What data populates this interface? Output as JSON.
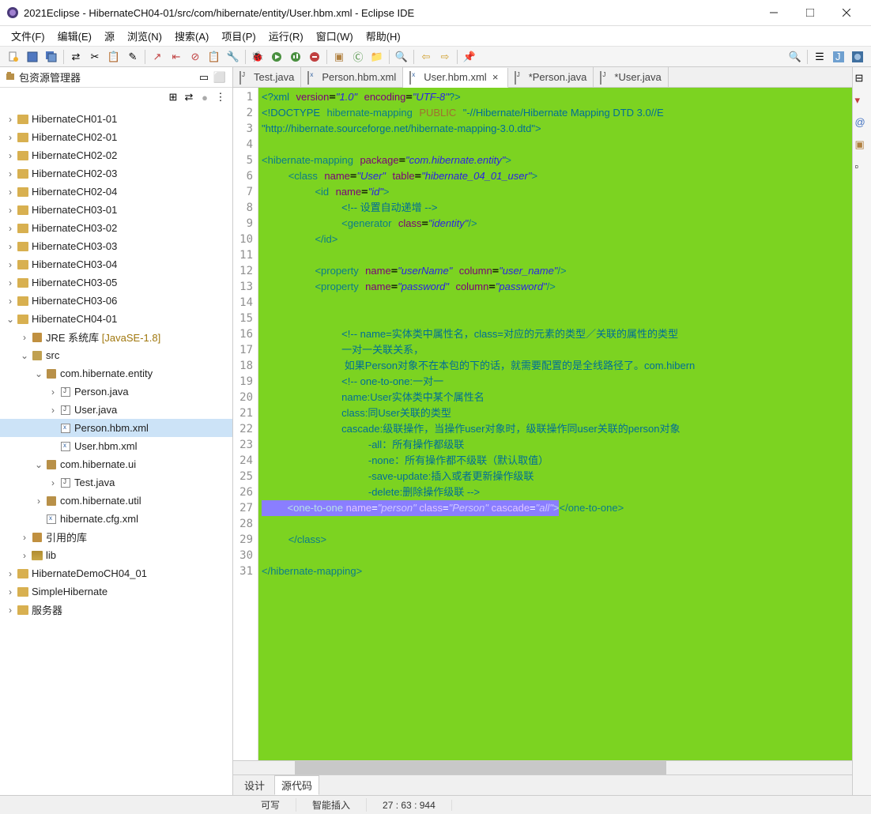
{
  "window": {
    "title": "2021Eclipse - HibernateCH04-01/src/com/hibernate/entity/User.hbm.xml - Eclipse IDE"
  },
  "menu": [
    "文件(F)",
    "编辑(E)",
    "源",
    "浏览(N)",
    "搜索(A)",
    "项目(P)",
    "运行(R)",
    "窗口(W)",
    "帮助(H)"
  ],
  "sidebar": {
    "title": "包资源管理器",
    "tree": [
      {
        "depth": 0,
        "exp": ">",
        "icon": "proj",
        "label": "HibernateCH01-01"
      },
      {
        "depth": 0,
        "exp": ">",
        "icon": "proj",
        "label": "HibernateCH02-01"
      },
      {
        "depth": 0,
        "exp": ">",
        "icon": "proj",
        "label": "HibernateCH02-02"
      },
      {
        "depth": 0,
        "exp": ">",
        "icon": "proj",
        "label": "HibernateCH02-03"
      },
      {
        "depth": 0,
        "exp": ">",
        "icon": "proj",
        "label": "HibernateCH02-04"
      },
      {
        "depth": 0,
        "exp": ">",
        "icon": "proj",
        "label": "HibernateCH03-01"
      },
      {
        "depth": 0,
        "exp": ">",
        "icon": "proj",
        "label": "HibernateCH03-02"
      },
      {
        "depth": 0,
        "exp": ">",
        "icon": "proj",
        "label": "HibernateCH03-03"
      },
      {
        "depth": 0,
        "exp": ">",
        "icon": "proj",
        "label": "HibernateCH03-04"
      },
      {
        "depth": 0,
        "exp": ">",
        "icon": "proj",
        "label": "HibernateCH03-05"
      },
      {
        "depth": 0,
        "exp": ">",
        "icon": "proj",
        "label": "HibernateCH03-06"
      },
      {
        "depth": 0,
        "exp": "v",
        "icon": "proj",
        "label": "HibernateCH04-01"
      },
      {
        "depth": 1,
        "exp": ">",
        "icon": "lib",
        "label": "JRE 系统库 [JavaSE-1.8]"
      },
      {
        "depth": 1,
        "exp": "v",
        "icon": "src",
        "label": "src"
      },
      {
        "depth": 2,
        "exp": "v",
        "icon": "pkg",
        "label": "com.hibernate.entity"
      },
      {
        "depth": 3,
        "exp": ">",
        "icon": "java",
        "label": "Person.java"
      },
      {
        "depth": 3,
        "exp": ">",
        "icon": "java",
        "label": "User.java"
      },
      {
        "depth": 3,
        "exp": " ",
        "icon": "xml",
        "label": "Person.hbm.xml",
        "selected": true
      },
      {
        "depth": 3,
        "exp": " ",
        "icon": "xml",
        "label": "User.hbm.xml"
      },
      {
        "depth": 2,
        "exp": "v",
        "icon": "pkg",
        "label": "com.hibernate.ui"
      },
      {
        "depth": 3,
        "exp": ">",
        "icon": "java",
        "label": "Test.java"
      },
      {
        "depth": 2,
        "exp": ">",
        "icon": "pkg",
        "label": "com.hibernate.util"
      },
      {
        "depth": 2,
        "exp": " ",
        "icon": "xml",
        "label": "hibernate.cfg.xml"
      },
      {
        "depth": 1,
        "exp": ">",
        "icon": "lib",
        "label": "引用的库"
      },
      {
        "depth": 1,
        "exp": ">",
        "icon": "folder",
        "label": "lib"
      },
      {
        "depth": 0,
        "exp": ">",
        "icon": "proj",
        "label": "HibernateDemoCH04_01"
      },
      {
        "depth": 0,
        "exp": ">",
        "icon": "proj",
        "label": "SimpleHibernate"
      },
      {
        "depth": 0,
        "exp": ">",
        "icon": "proj",
        "label": "服务器"
      }
    ]
  },
  "tabs": [
    {
      "icon": "java",
      "label": "Test.java",
      "active": false,
      "dirty": false
    },
    {
      "icon": "xml",
      "label": "Person.hbm.xml",
      "active": false,
      "dirty": false
    },
    {
      "icon": "xml",
      "label": "User.hbm.xml",
      "active": true,
      "dirty": false
    },
    {
      "icon": "java",
      "label": "*Person.java",
      "active": false,
      "dirty": true
    },
    {
      "icon": "java",
      "label": "*User.java",
      "active": false,
      "dirty": true
    }
  ],
  "code_lines": 31,
  "viewtabs": {
    "design": "设计",
    "source": "源代码"
  },
  "status": {
    "writable": "可写",
    "insert": "智能插入",
    "pos": "27 : 63 : 944"
  }
}
